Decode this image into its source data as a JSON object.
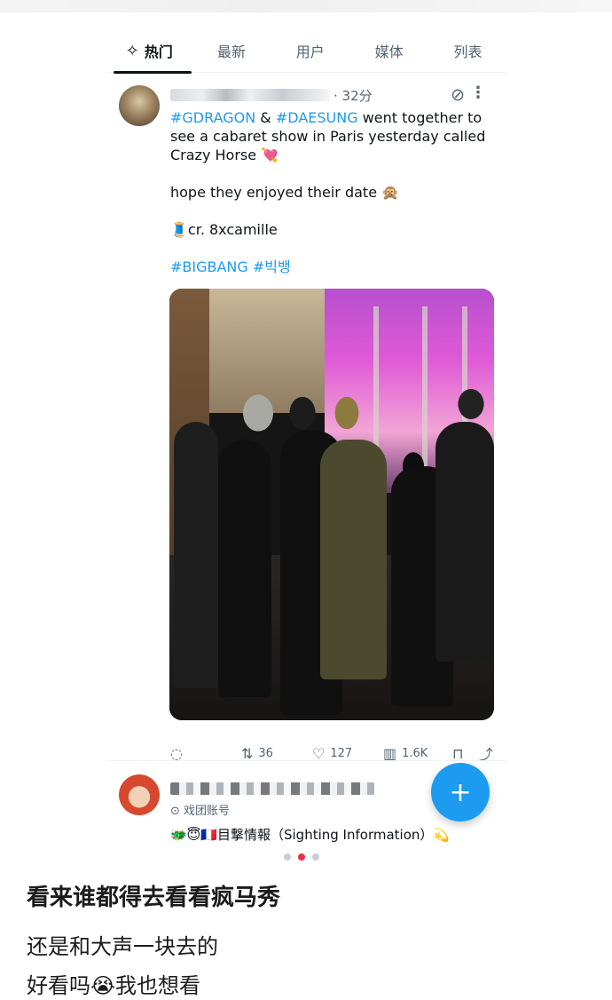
{
  "tabs": [
    {
      "label": "热门",
      "icon": "sparkle-icon",
      "active": true
    },
    {
      "label": "最新"
    },
    {
      "label": "用户"
    },
    {
      "label": "媒体"
    },
    {
      "label": "列表"
    }
  ],
  "post": {
    "time": "32分",
    "line1_tag1": "#GDRAGON",
    "line1_amp": " & ",
    "line1_tag2": "#DAESUNG",
    "line1_rest": " went together to see a cabaret show in Paris yesterday called Crazy Horse 💘",
    "line2": "hope they enjoyed their date 🙊",
    "line3": "🧵cr. 8xcamille",
    "hashtags": "#BIGBANG #빅뱅",
    "stats": {
      "retweets": "36",
      "likes": "127",
      "views": "1.6K"
    }
  },
  "post2": {
    "account_type": "⊙ 戏团账号",
    "text": "🐲😇🇫🇷目撃情報（Sighting Information）💫"
  },
  "carousel": {
    "total": 3,
    "active_index": 1
  },
  "captions": {
    "line1": "看来谁都得去看看疯马秀",
    "line2": "还是和大声一块去的",
    "line3": "好看吗😭我也想看"
  },
  "colors": {
    "accent": "#1d9bf0",
    "active_dot": "#e3344b"
  }
}
